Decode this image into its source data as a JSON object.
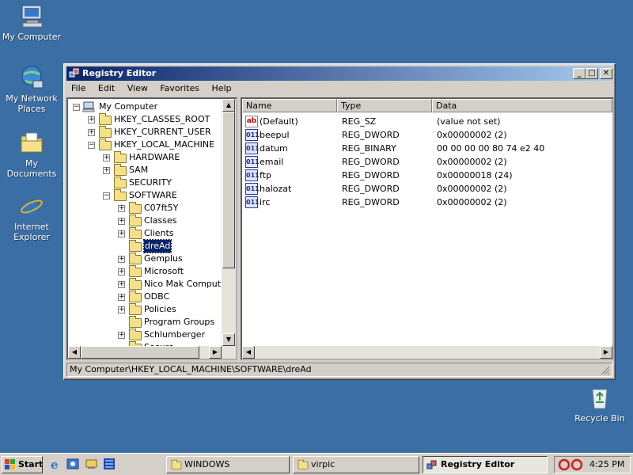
{
  "desktop": {
    "icons": [
      {
        "label": "My Computer",
        "icon": "my-computer-icon"
      },
      {
        "label": "My Network Places",
        "icon": "network-places-icon"
      },
      {
        "label": "My Documents",
        "icon": "my-documents-icon"
      },
      {
        "label": "Internet Explorer",
        "icon": "internet-explorer-icon"
      },
      {
        "label": "Recycle Bin",
        "icon": "recycle-bin-icon"
      }
    ]
  },
  "window": {
    "title": "Registry Editor",
    "menu": [
      "File",
      "Edit",
      "View",
      "Favorites",
      "Help"
    ],
    "tree": [
      {
        "label": "My Computer",
        "expander": "−"
      },
      {
        "label": "HKEY_CLASSES_ROOT",
        "expander": "+"
      },
      {
        "label": "HKEY_CURRENT_USER",
        "expander": "+"
      },
      {
        "label": "HKEY_LOCAL_MACHINE",
        "expander": "−"
      },
      {
        "label": "HARDWARE",
        "expander": "+"
      },
      {
        "label": "SAM",
        "expander": "+"
      },
      {
        "label": "SECURITY",
        "expander": ""
      },
      {
        "label": "SOFTWARE",
        "expander": "−"
      },
      {
        "label": "C07ft5Y",
        "expander": "+"
      },
      {
        "label": "Classes",
        "expander": "+"
      },
      {
        "label": "Clients",
        "expander": "+"
      },
      {
        "label": "dreAd",
        "expander": ""
      },
      {
        "label": "Gemplus",
        "expander": "+"
      },
      {
        "label": "Microsoft",
        "expander": "+"
      },
      {
        "label": "Nico Mak Computing",
        "expander": "+"
      },
      {
        "label": "ODBC",
        "expander": "+"
      },
      {
        "label": "Policies",
        "expander": "+"
      },
      {
        "label": "Program Groups",
        "expander": ""
      },
      {
        "label": "Schlumberger",
        "expander": "+"
      },
      {
        "label": "Secure",
        "expander": ""
      }
    ],
    "columns": [
      "Name",
      "Type",
      "Data"
    ],
    "values": [
      {
        "name": "(Default)",
        "type": "REG_SZ",
        "data": "(value not set)",
        "icon": "ab"
      },
      {
        "name": "beepul",
        "type": "REG_DWORD",
        "data": "0x00000002 (2)",
        "icon": "011"
      },
      {
        "name": "datum",
        "type": "REG_BINARY",
        "data": "00 00 00 00 80 74 e2 40",
        "icon": "011"
      },
      {
        "name": "email",
        "type": "REG_DWORD",
        "data": "0x00000002 (2)",
        "icon": "011"
      },
      {
        "name": "ftp",
        "type": "REG_DWORD",
        "data": "0x00000018 (24)",
        "icon": "011"
      },
      {
        "name": "halozat",
        "type": "REG_DWORD",
        "data": "0x00000002 (2)",
        "icon": "011"
      },
      {
        "name": "irc",
        "type": "REG_DWORD",
        "data": "0x00000002 (2)",
        "icon": "011"
      }
    ],
    "status_path": "My Computer\\HKEY_LOCAL_MACHINE\\SOFTWARE\\dreAd",
    "title_buttons": {
      "minimize": "_",
      "maximize": "□",
      "close": "✕"
    }
  },
  "taskbar": {
    "start_label": "Start",
    "buttons": [
      {
        "label": "WINDOWS",
        "active": false
      },
      {
        "label": "virpic",
        "active": false
      },
      {
        "label": "Registry Editor",
        "active": true
      }
    ],
    "clock": "4:25 PM"
  },
  "colors": {
    "desktop": "#3a6ea5",
    "titlebar": "#0a246a",
    "face": "#d4d0c8"
  }
}
